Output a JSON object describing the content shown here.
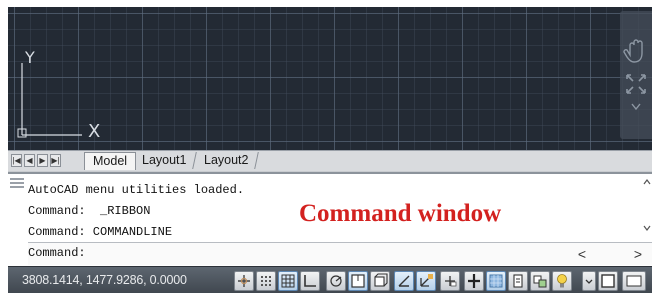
{
  "canvas": {
    "ucs_y_label": "Y",
    "ucs_x_label": "X"
  },
  "layout_tabs": {
    "nav_first": "|◀",
    "nav_prev": "◀",
    "nav_next": "▶",
    "nav_last": "▶|",
    "tabs": [
      {
        "label": "Model"
      },
      {
        "label": "Layout1"
      },
      {
        "label": "Layout2"
      }
    ]
  },
  "command_window": {
    "history": [
      "AutoCAD menu utilities loaded.",
      "Command:  _RIBBON",
      "Command: COMMANDLINE"
    ],
    "annotation": "Command window",
    "input_value": "Command:",
    "scroll_left": "<",
    "scroll_right": ">"
  },
  "status_bar": {
    "coordinates": "3808.1414, 1477.9286, 0.0000",
    "icons": [
      "infer-constraints-icon",
      "snap-mode-icon",
      "grid-display-icon",
      "ortho-mode-icon",
      "polar-tracking-icon",
      "object-snap-icon",
      "3d-object-snap-icon",
      "object-snap-tracking-icon",
      "dynamic-ucs-icon",
      "dynamic-input-icon",
      "lineweight-icon",
      "transparency-icon",
      "quick-properties-icon",
      "selection-cycling-icon",
      "isolate-objects-icon",
      "toolbar-menu-icon",
      "clean-screen-icon"
    ]
  },
  "colors": {
    "canvas_bg": "#232a34",
    "annotation": "#d3211f",
    "status_bar": "#4f5760"
  }
}
